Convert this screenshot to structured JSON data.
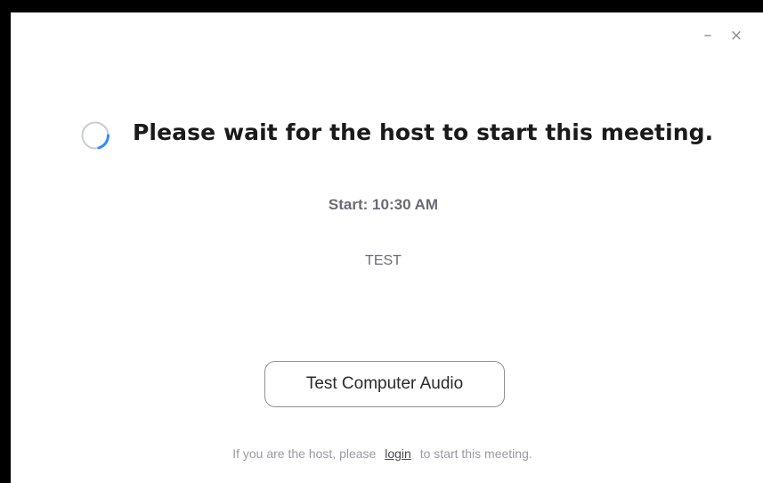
{
  "window": {
    "controls": {
      "minimize_glyph": "–",
      "close_glyph": "×"
    }
  },
  "main": {
    "heading": "Please wait for the host to start this meeting.",
    "start_time": "Start: 10:30 AM",
    "topic": "TEST",
    "audio_button_label": "Test Computer Audio"
  },
  "footer": {
    "text_before": "If you are the host, please",
    "login_link": "login",
    "text_after": "to start this meeting."
  },
  "colors": {
    "spinner_accent": "#2d8cff",
    "spinner_track": "#c8ccd4"
  },
  "icons": {
    "spinner": "loading-spinner-icon",
    "minimize": "minimize-icon",
    "close": "close-icon"
  }
}
